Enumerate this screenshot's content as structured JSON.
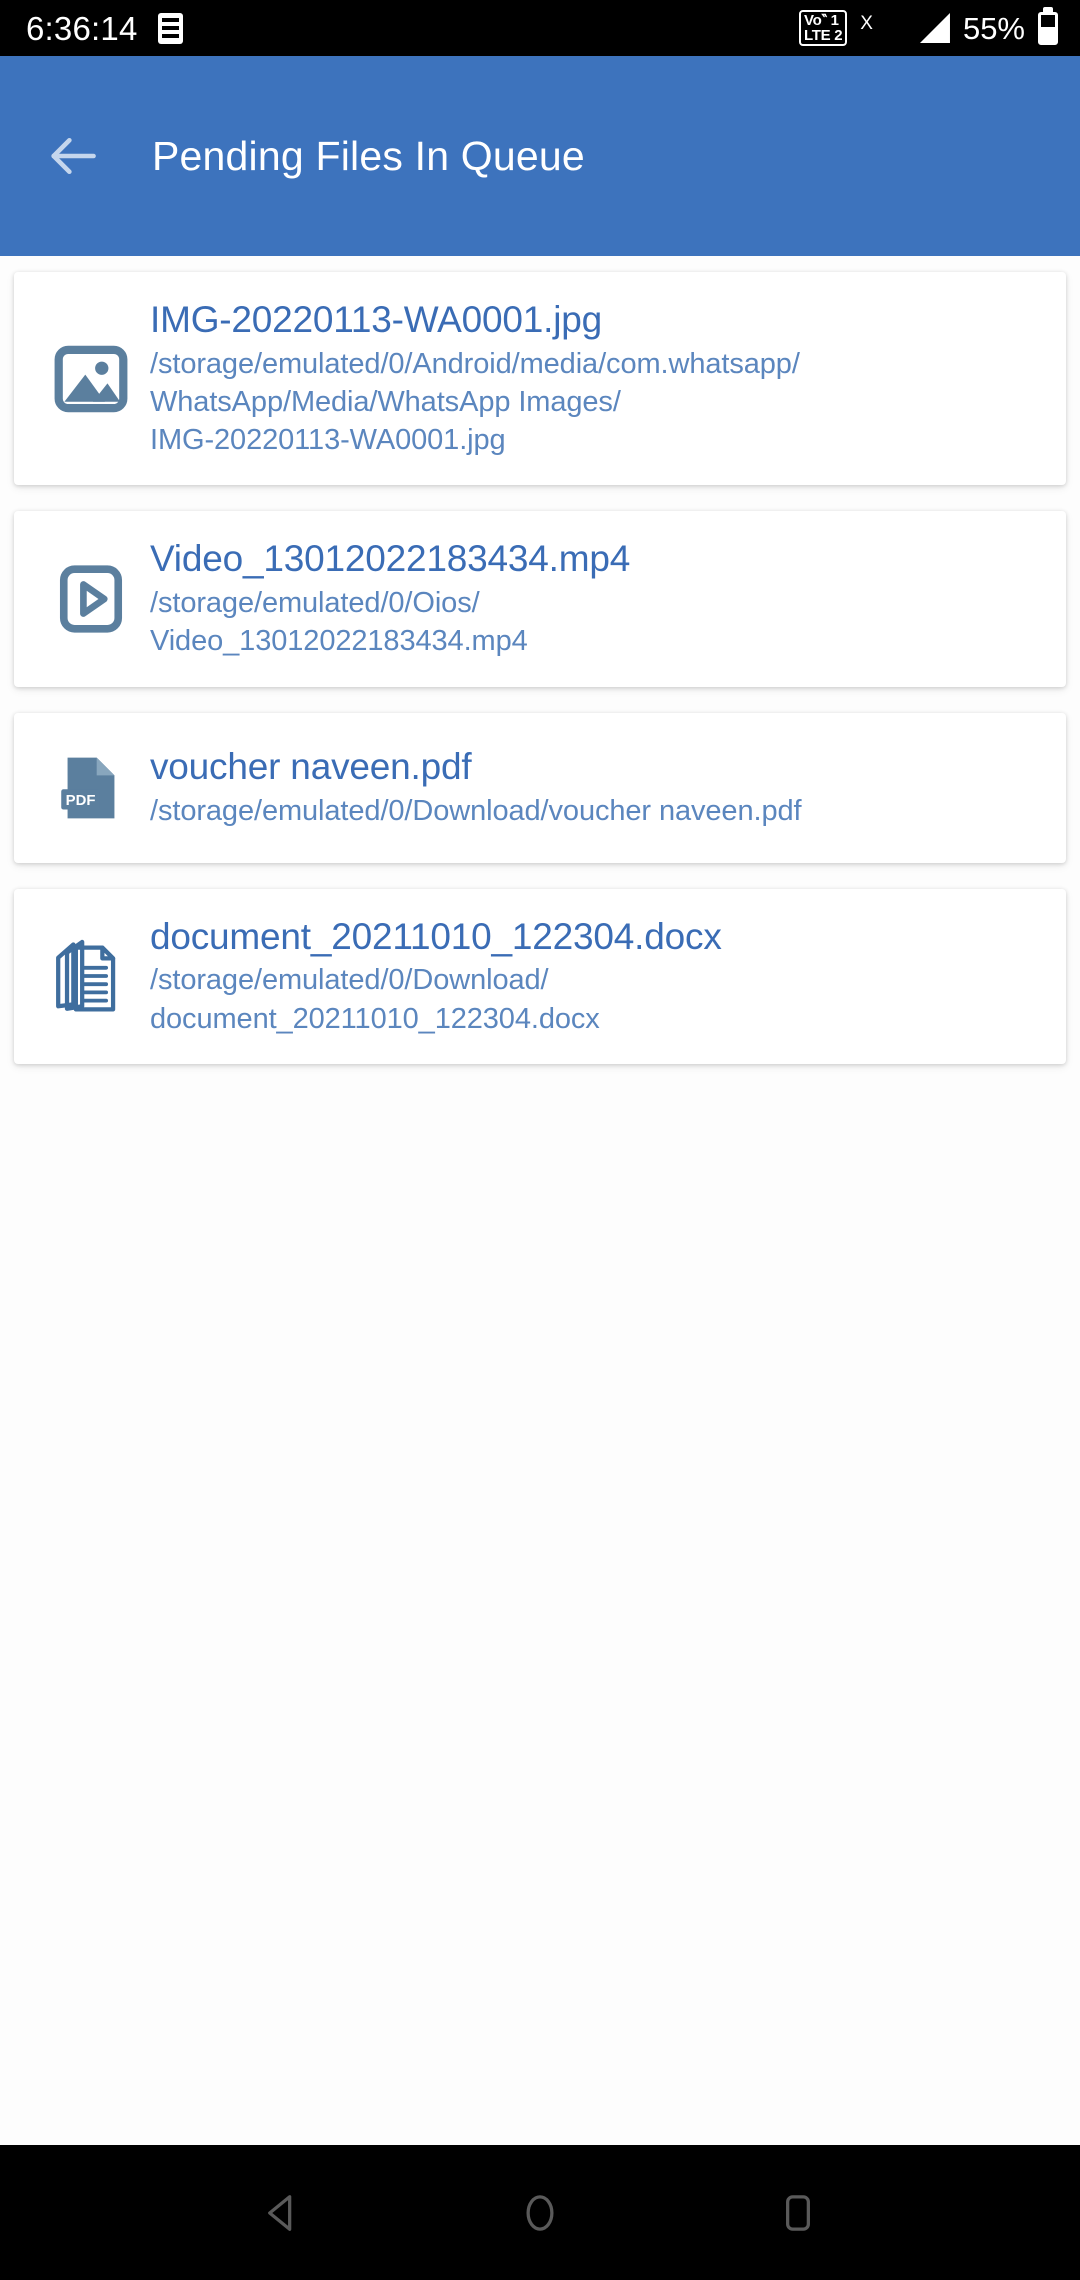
{
  "status_bar": {
    "clock": "6:36:14",
    "notification_icon": "notification-list-icon",
    "volte_line1": "Vo‶ 1",
    "volte_line2": "LTE 2",
    "sim_x": "X",
    "signal_icon_1": "signal-bars-crossed-icon",
    "signal_icon_2": "signal-bars-icon",
    "battery_percent": "55%",
    "battery_icon": "battery-icon"
  },
  "app_bar": {
    "back_icon": "back-arrow-icon",
    "title": "Pending Files In Queue",
    "background_color": "#3d73bd",
    "title_color": "#ffffff"
  },
  "colors": {
    "accent": "#3d73bd",
    "file_name": "#3a6cb5",
    "file_path": "#5b86be",
    "icon_blue_grey": "#5b7f9e",
    "page_background": "#fdfdfd",
    "card_background": "#ffffff",
    "status_bar_background": "#000000",
    "nav_bar_background": "#000000"
  },
  "files": [
    {
      "icon": "image-file-icon",
      "name": "IMG-20220113-WA0001.jpg",
      "path": "/storage/emulated/0/Android/media/com.whatsapp/\nWhatsApp/Media/WhatsApp Images/\nIMG-20220113-WA0001.jpg"
    },
    {
      "icon": "video-file-icon",
      "name": "Video_13012022183434.mp4",
      "path": "/storage/emulated/0/Oios/\nVideo_13012022183434.mp4"
    },
    {
      "icon": "pdf-file-icon",
      "name": "voucher naveen.pdf",
      "path": "/storage/emulated/0/Download/voucher naveen.pdf"
    },
    {
      "icon": "docx-file-icon",
      "name": "document_20211010_122304.docx",
      "path": "/storage/emulated/0/Download/\ndocument_20211010_122304.docx"
    }
  ],
  "nav_bar": {
    "back": "nav-back-triangle-icon",
    "home": "nav-home-circle-icon",
    "recents": "nav-recents-square-icon"
  }
}
